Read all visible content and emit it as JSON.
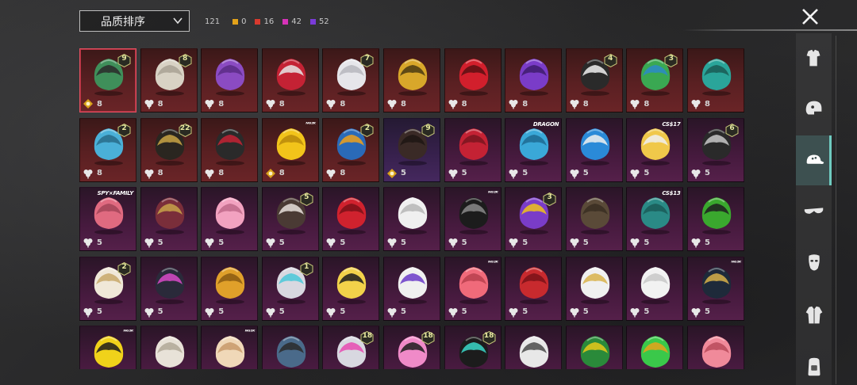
{
  "header": {
    "sort_label": "品质排序",
    "total_count": "121",
    "rarity_counts": [
      {
        "color": "#e3a21a",
        "count": "0"
      },
      {
        "color": "#d83a2e",
        "count": "16"
      },
      {
        "color": "#d632b8",
        "count": "42"
      },
      {
        "color": "#7a3bd8",
        "count": "52"
      }
    ]
  },
  "colors": {
    "red_rarity": "#6a2427",
    "pink_rarity": "#55204a",
    "purple_rarity": "#45285e",
    "accent_active": "#6fcbc0"
  },
  "grid": {
    "rows": [
      [
        {
          "rarity": "red",
          "badge": "9",
          "icon": "gold-clover-icon",
          "count": "8",
          "img": "zombie-head",
          "selected": true
        },
        {
          "rarity": "red",
          "badge": "8",
          "icon": "clover-icon",
          "count": "8",
          "img": "silver-hair"
        },
        {
          "rarity": "red",
          "badge": "",
          "icon": "clover-icon",
          "count": "8",
          "img": "purple-hair"
        },
        {
          "rarity": "red",
          "badge": "",
          "icon": "clover-icon",
          "count": "8",
          "img": "red-mask"
        },
        {
          "rarity": "red",
          "badge": "7",
          "icon": "clover-icon",
          "count": "8",
          "img": "white-hair"
        },
        {
          "rarity": "red",
          "badge": "",
          "icon": "clover-icon",
          "count": "8",
          "img": "gold-helmet"
        },
        {
          "rarity": "red",
          "badge": "",
          "icon": "clover-icon",
          "count": "8",
          "img": "red-helmet"
        },
        {
          "rarity": "red",
          "badge": "",
          "icon": "clover-icon",
          "count": "8",
          "img": "violet-hair"
        },
        {
          "rarity": "red",
          "badge": "4",
          "icon": "clover-icon",
          "count": "8",
          "img": "eye-hat"
        },
        {
          "rarity": "red",
          "badge": "3",
          "icon": "clover-icon",
          "count": "8",
          "img": "joker-hair"
        },
        {
          "rarity": "red",
          "badge": "",
          "icon": "clover-icon",
          "count": "8",
          "img": "teal-mask"
        }
      ],
      [
        {
          "rarity": "red",
          "badge": "2",
          "icon": "clover-icon",
          "count": "8",
          "img": "blue-cap"
        },
        {
          "rarity": "red",
          "badge": "22",
          "icon": "clover-icon",
          "count": "8",
          "img": "black-gold-hair"
        },
        {
          "rarity": "red",
          "badge": "",
          "icon": "clover-icon",
          "count": "8",
          "img": "oni-mask"
        },
        {
          "rarity": "red",
          "badge": "",
          "brand": "ᴺᴳ²ᴷ",
          "icon": "gold-clover-icon",
          "count": "8",
          "img": "yellow-hair"
        },
        {
          "rarity": "red",
          "badge": "2",
          "icon": "clover-icon",
          "count": "8",
          "img": "blue-helmet"
        },
        {
          "rarity": "purple",
          "badge": "9",
          "icon": "gold-clover-icon",
          "count": "5",
          "img": "dark-hair"
        },
        {
          "rarity": "pink",
          "badge": "",
          "icon": "clover-icon",
          "count": "5",
          "img": "red-long-hair"
        },
        {
          "rarity": "pink",
          "badge": "",
          "brand": "DRAGON",
          "icon": "clover-icon",
          "count": "5",
          "img": "blue-spiky-hair"
        },
        {
          "rarity": "pink",
          "badge": "",
          "icon": "clover-icon",
          "count": "5",
          "img": "blue-cat-cap"
        },
        {
          "rarity": "pink",
          "badge": "",
          "brand": "CS$17",
          "icon": "clover-icon",
          "count": "5",
          "img": "yellow-cap"
        },
        {
          "rarity": "pink",
          "badge": "6",
          "icon": "clover-icon",
          "count": "5",
          "img": "armor-helmet"
        }
      ],
      [
        {
          "rarity": "pink",
          "badge": "",
          "brand": "SPY×FAMILY",
          "icon": "clover-icon",
          "count": "5",
          "img": "pink-bob"
        },
        {
          "rarity": "pink",
          "badge": "",
          "icon": "clover-icon",
          "count": "5",
          "img": "witch-hat"
        },
        {
          "rarity": "pink",
          "badge": "",
          "icon": "clover-icon",
          "count": "5",
          "img": "pink-twintail"
        },
        {
          "rarity": "pink",
          "badge": "5",
          "icon": "clover-icon",
          "count": "5",
          "img": "bear-ears"
        },
        {
          "rarity": "pink",
          "badge": "",
          "icon": "clover-icon",
          "count": "5",
          "img": "red-mane"
        },
        {
          "rarity": "pink",
          "badge": "",
          "icon": "clover-icon",
          "count": "5",
          "img": "polar-bear"
        },
        {
          "rarity": "pink",
          "badge": "",
          "brand": "ᴺᴳ²ᴷ",
          "icon": "clover-icon",
          "count": "5",
          "img": "black-mask"
        },
        {
          "rarity": "pink",
          "badge": "3",
          "icon": "clover-icon",
          "count": "5",
          "img": "jester-hat"
        },
        {
          "rarity": "pink",
          "badge": "",
          "icon": "clover-icon",
          "count": "5",
          "img": "cowboy-hat"
        },
        {
          "rarity": "pink",
          "badge": "",
          "brand": "CS$13",
          "icon": "clover-icon",
          "count": "5",
          "img": "teal-beanie"
        },
        {
          "rarity": "pink",
          "badge": "",
          "icon": "clover-icon",
          "count": "5",
          "img": "green-helmet"
        }
      ],
      [
        {
          "rarity": "pink",
          "badge": "2",
          "icon": "clover-icon",
          "count": "5",
          "img": "bandana-hair"
        },
        {
          "rarity": "pink",
          "badge": "",
          "icon": "clover-icon",
          "count": "5",
          "img": "cyber-mask"
        },
        {
          "rarity": "pink",
          "badge": "",
          "icon": "clover-icon",
          "count": "5",
          "img": "duck-head"
        },
        {
          "rarity": "pink",
          "badge": "1",
          "icon": "clover-icon",
          "count": "5",
          "img": "silver-pigtails"
        },
        {
          "rarity": "pink",
          "badge": "",
          "icon": "clover-icon",
          "count": "5",
          "img": "banana-hat"
        },
        {
          "rarity": "pink",
          "badge": "",
          "icon": "clover-icon",
          "count": "5",
          "img": "unicorn-headset"
        },
        {
          "rarity": "pink",
          "badge": "",
          "brand": "ᴺᴳ²ᴷ",
          "icon": "clover-icon",
          "count": "5",
          "img": "pink-hair"
        },
        {
          "rarity": "pink",
          "badge": "",
          "icon": "clover-icon",
          "count": "5",
          "img": "red-curls"
        },
        {
          "rarity": "pink",
          "badge": "",
          "icon": "clover-icon",
          "count": "5",
          "img": "crown-hair"
        },
        {
          "rarity": "pink",
          "badge": "",
          "icon": "clover-icon",
          "count": "5",
          "img": "white-blob"
        },
        {
          "rarity": "pink",
          "badge": "",
          "brand": "ᴺᴳ²ᴷ",
          "icon": "clover-icon",
          "count": "5",
          "img": "dark-helmet"
        }
      ],
      [
        {
          "rarity": "pink",
          "badge": "",
          "brand": "ᴺᴳ²ᴷ",
          "icon": "clover-icon",
          "count": "",
          "img": "yellow-helmet"
        },
        {
          "rarity": "pink",
          "badge": "",
          "icon": "clover-icon",
          "count": "",
          "img": "chicken"
        },
        {
          "rarity": "pink",
          "badge": "",
          "brand": "ᴺᴳ²ᴷ",
          "icon": "clover-icon",
          "count": "",
          "img": "fox-head"
        },
        {
          "rarity": "pink",
          "badge": "",
          "icon": "clover-icon",
          "count": "",
          "img": "tv-head"
        },
        {
          "rarity": "pink",
          "badge": "18",
          "icon": "clover-icon",
          "count": "",
          "img": "pink-helmet"
        },
        {
          "rarity": "pink",
          "badge": "18",
          "icon": "clover-icon",
          "count": "",
          "img": "punk-hat"
        },
        {
          "rarity": "pink",
          "badge": "18",
          "icon": "clover-icon",
          "count": "",
          "img": "black-cap"
        },
        {
          "rarity": "pink",
          "badge": "",
          "icon": "clover-icon",
          "count": "",
          "img": "dread-lion"
        },
        {
          "rarity": "pink",
          "badge": "",
          "icon": "clover-icon",
          "count": "",
          "img": "frog-cap"
        },
        {
          "rarity": "pink",
          "badge": "",
          "icon": "clover-icon",
          "count": "",
          "img": "goggles-frog"
        },
        {
          "rarity": "pink",
          "badge": "",
          "icon": "clover-icon",
          "count": "",
          "img": "pink-tank"
        }
      ]
    ]
  },
  "sidebar": {
    "items": [
      {
        "name": "outfit-icon",
        "active": false
      },
      {
        "name": "helmet-icon",
        "active": false
      },
      {
        "name": "cap-icon",
        "active": true
      },
      {
        "name": "sunglasses-icon",
        "active": false
      },
      {
        "name": "mask-icon",
        "active": false
      },
      {
        "name": "jacket-icon",
        "active": false
      },
      {
        "name": "backpack-icon",
        "active": false
      }
    ]
  }
}
